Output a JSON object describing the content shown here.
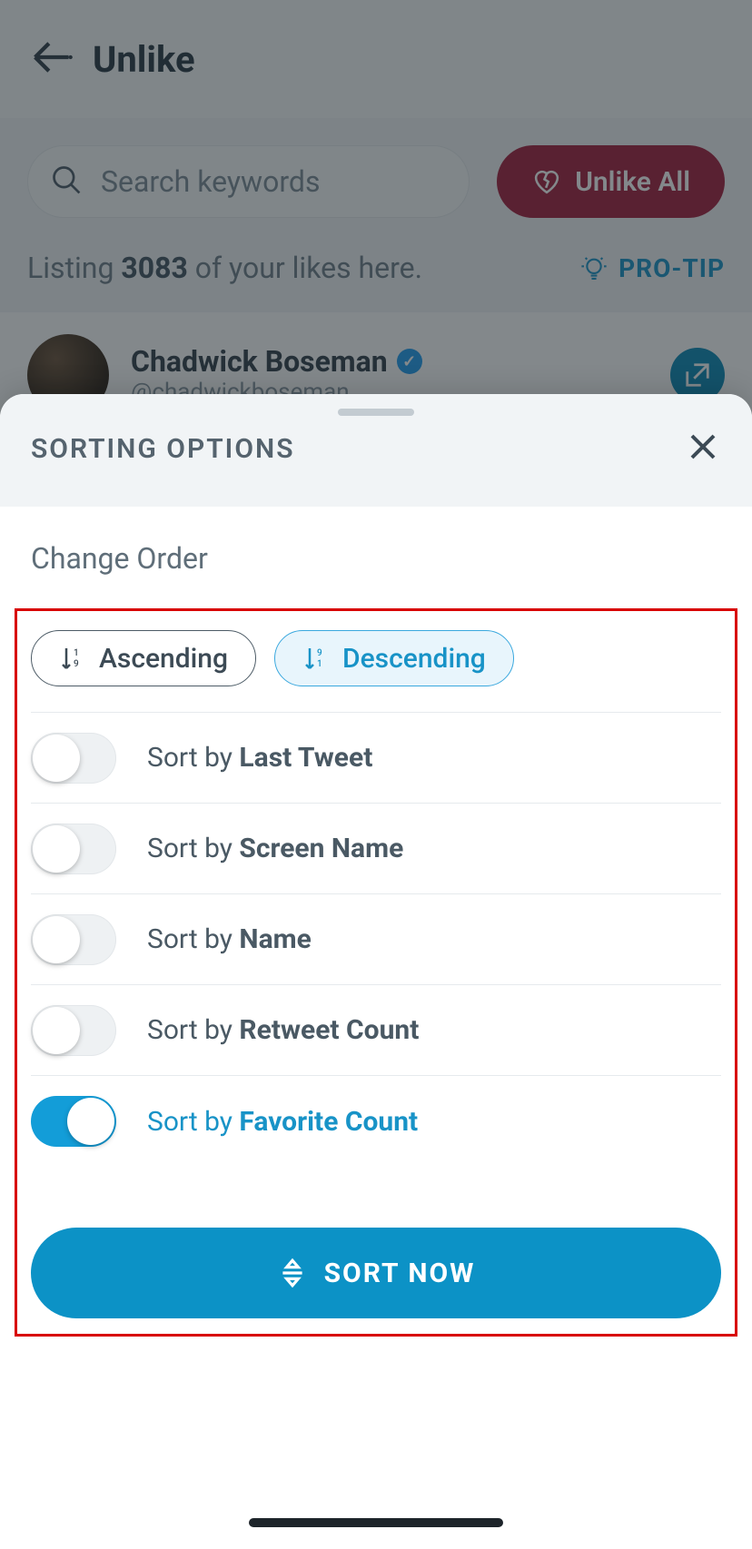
{
  "header": {
    "title": "Unlike"
  },
  "search": {
    "placeholder": "Search keywords"
  },
  "unlike_all_label": "Unlike All",
  "listing": {
    "prefix": "Listing ",
    "count": "3083",
    "suffix": " of your likes here."
  },
  "protip_label": "PRO-TIP",
  "tweet": {
    "name": "Chadwick Boseman",
    "handle": "@chadwickboseman"
  },
  "sheet": {
    "title": "SORTING OPTIONS",
    "subhead": "Change Order",
    "order": {
      "ascending": "Ascending",
      "descending": "Descending",
      "selected": "descending"
    },
    "sort_prefix": "Sort by ",
    "options": [
      {
        "label": "Last Tweet",
        "on": false
      },
      {
        "label": "Screen Name",
        "on": false
      },
      {
        "label": "Name",
        "on": false
      },
      {
        "label": "Retweet Count",
        "on": false
      },
      {
        "label": "Favorite Count",
        "on": true
      }
    ],
    "button": "SORT NOW"
  }
}
